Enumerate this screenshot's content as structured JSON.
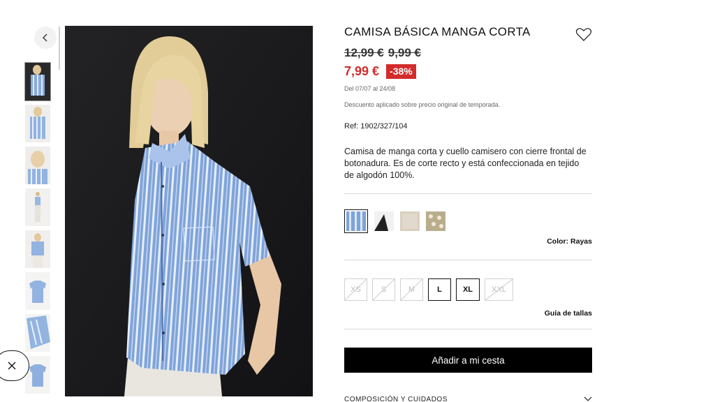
{
  "product": {
    "title": "CAMISA BÁSICA MANGA CORTA",
    "old_price_1": "12,99 €",
    "old_price_2": "9,99 €",
    "price": "7,99 €",
    "discount": "-38%",
    "dates": "Del 07/07 al 24/08",
    "discount_note": "Descuento aplicado sobre precio original de temporada.",
    "ref": "Ref: 1902/327/104",
    "description": "Camisa de manga corta y cuello camisero con cierre frontal de botonadura. Es de corte recto y está confeccionada en tejido de algodón 100%."
  },
  "colors": {
    "label": "Color: Rayas",
    "swatches": [
      {
        "name": "Rayas",
        "color": "#7ea3d8",
        "selected": true
      },
      {
        "name": "Negro",
        "color": "#222222",
        "selected": false
      },
      {
        "name": "Beige",
        "color": "#d8cfbf",
        "selected": false
      },
      {
        "name": "Estampado",
        "color": "#b9ad8c",
        "selected": false
      }
    ]
  },
  "sizes": {
    "items": [
      {
        "label": "XS",
        "available": false
      },
      {
        "label": "S",
        "available": false
      },
      {
        "label": "M",
        "available": false
      },
      {
        "label": "L",
        "available": true
      },
      {
        "label": "XL",
        "available": true
      },
      {
        "label": "XXL",
        "available": false
      }
    ],
    "guide_label": "Guía de tallas"
  },
  "actions": {
    "add_to_cart": "Añadir a mi cesta"
  },
  "composition": {
    "label": "COMPOSICIÓN Y CUIDADOS"
  },
  "icons": {
    "wishlist": "heart-icon",
    "thumb_up": "chevron-left-icon",
    "close": "close-icon",
    "expand": "chevron-down-icon"
  }
}
